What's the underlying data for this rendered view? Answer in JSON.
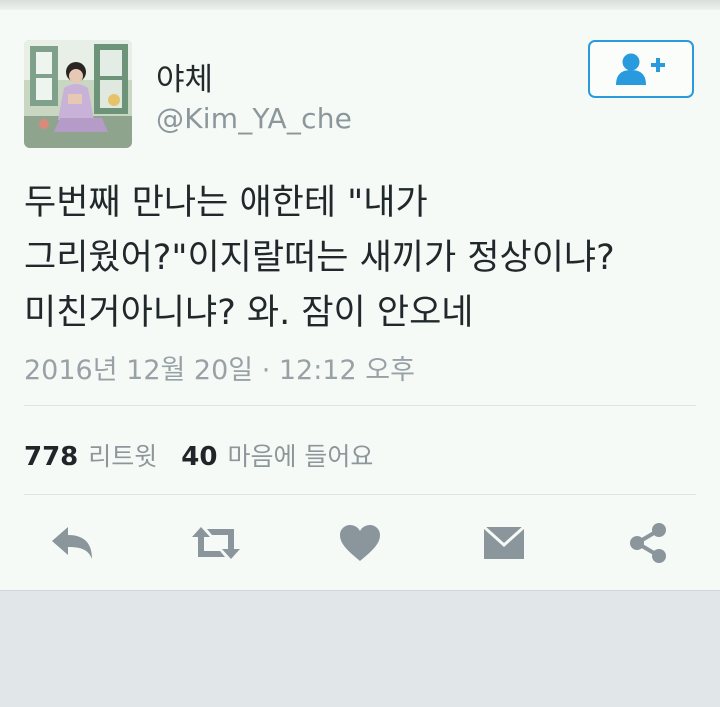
{
  "profile": {
    "name": "야체",
    "handle": "@Kim_YA_che"
  },
  "follow_button": {
    "icon": "add-user-icon",
    "color": "#2a9adf"
  },
  "tweet": {
    "text": "두번째 만나는 애한테 \"내가\n그리웠어?\"이지랄떠는 새끼가 정상이냐?\n미친거아니냐? 와. 잠이 안오네",
    "timestamp": "2016년 12월 20일 · 12:12 오후"
  },
  "stats": {
    "retweets": "778",
    "retweets_label": "리트윗",
    "likes": "40",
    "likes_label": "마음에 들어요"
  },
  "actions": [
    {
      "name": "reply-icon"
    },
    {
      "name": "retweet-icon"
    },
    {
      "name": "like-heart-icon"
    },
    {
      "name": "direct-message-icon"
    },
    {
      "name": "share-icon"
    }
  ],
  "colors": {
    "icon_gray": "#8a969c",
    "accent": "#2a9adf",
    "background": "#f6faf6"
  }
}
